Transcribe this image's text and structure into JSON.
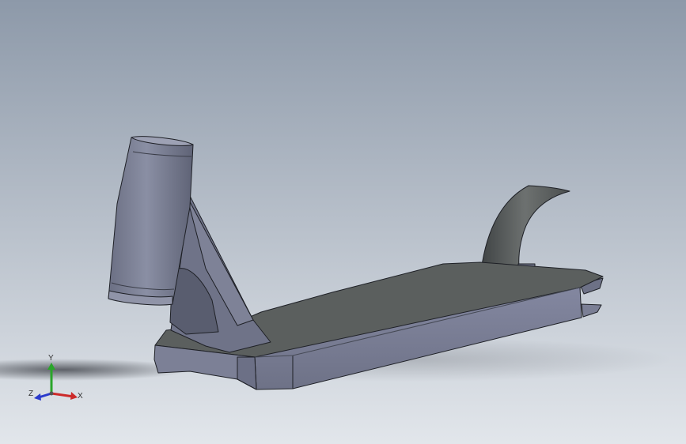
{
  "viewport": {
    "background_top": "#8d99a9",
    "background_bottom": "#e2e6eb"
  },
  "triad": {
    "x_label": "X",
    "y_label": "Y",
    "z_label": "Z",
    "x_color": "#cc2a2a",
    "y_color": "#2aa52a",
    "z_color": "#2a3acc"
  },
  "model": {
    "body_color": "#7a7f92",
    "top_color": "#5b5f5e",
    "dark_color": "#4e5260",
    "edge_color": "#1e2026"
  }
}
